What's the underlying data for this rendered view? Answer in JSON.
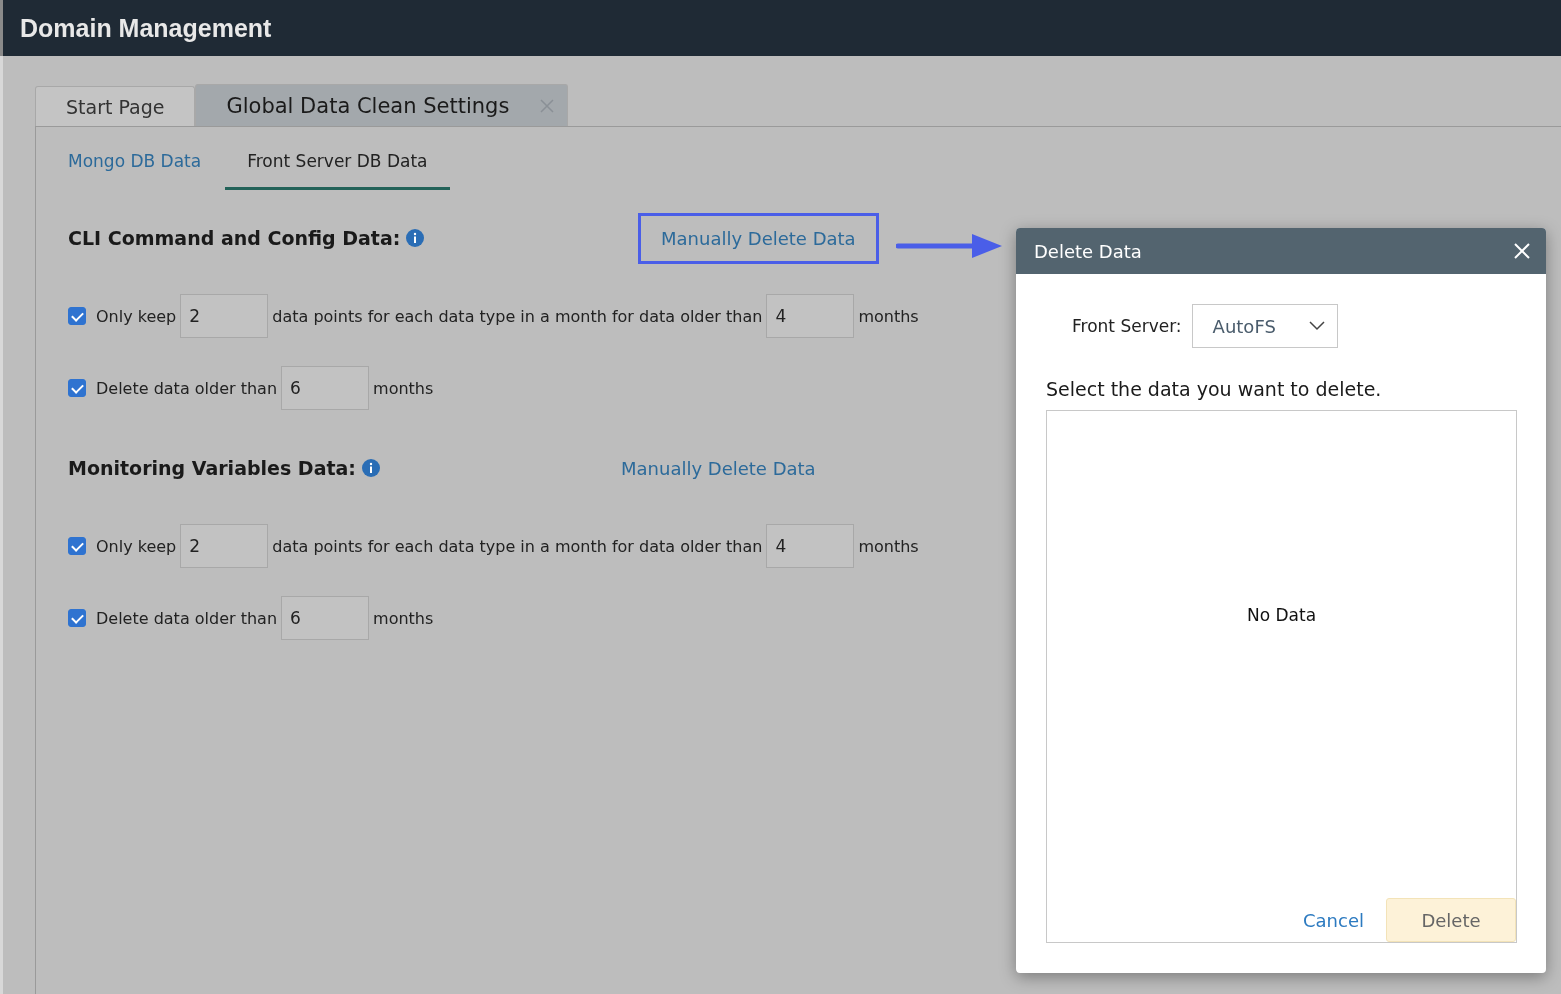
{
  "header": {
    "title": "Domain Management"
  },
  "tabs": [
    {
      "label": "Start Page",
      "selected": false,
      "closable": false
    },
    {
      "label": "Global Data Clean Settings",
      "selected": true,
      "closable": true
    }
  ],
  "subtabs": [
    {
      "label": "Mongo DB Data",
      "selected": false
    },
    {
      "label": "Front Server DB Data",
      "selected": true
    }
  ],
  "sections": [
    {
      "title": "CLI Command and Config Data:",
      "link": "Manually Delete Data",
      "highlighted": true,
      "rows": [
        {
          "checked": true,
          "parts": [
            {
              "kind": "text",
              "text": "Only keep"
            },
            {
              "kind": "input",
              "value": "2"
            },
            {
              "kind": "text",
              "text": "data points for each data type in a month for data older than"
            },
            {
              "kind": "input",
              "value": "4"
            },
            {
              "kind": "text",
              "text": "months"
            }
          ]
        },
        {
          "checked": true,
          "parts": [
            {
              "kind": "text",
              "text": "Delete data older than"
            },
            {
              "kind": "input",
              "value": "6"
            },
            {
              "kind": "text",
              "text": "months"
            }
          ]
        }
      ]
    },
    {
      "title": "Monitoring Variables Data:",
      "link": "Manually Delete Data",
      "highlighted": false,
      "rows": [
        {
          "checked": true,
          "parts": [
            {
              "kind": "text",
              "text": "Only keep"
            },
            {
              "kind": "input",
              "value": "2"
            },
            {
              "kind": "text",
              "text": "data points for each data type in a month for data older than"
            },
            {
              "kind": "input",
              "value": "4"
            },
            {
              "kind": "text",
              "text": "months"
            }
          ]
        },
        {
          "checked": true,
          "parts": [
            {
              "kind": "text",
              "text": "Delete data older than"
            },
            {
              "kind": "input",
              "value": "6"
            },
            {
              "kind": "text",
              "text": "months"
            }
          ]
        }
      ]
    }
  ],
  "dialog": {
    "title": "Delete Data",
    "server_label": "Front Server:",
    "server_value": "AutoFS",
    "prompt": "Select the data you want to delete.",
    "empty_text": "No Data",
    "cancel": "Cancel",
    "delete": "Delete"
  }
}
